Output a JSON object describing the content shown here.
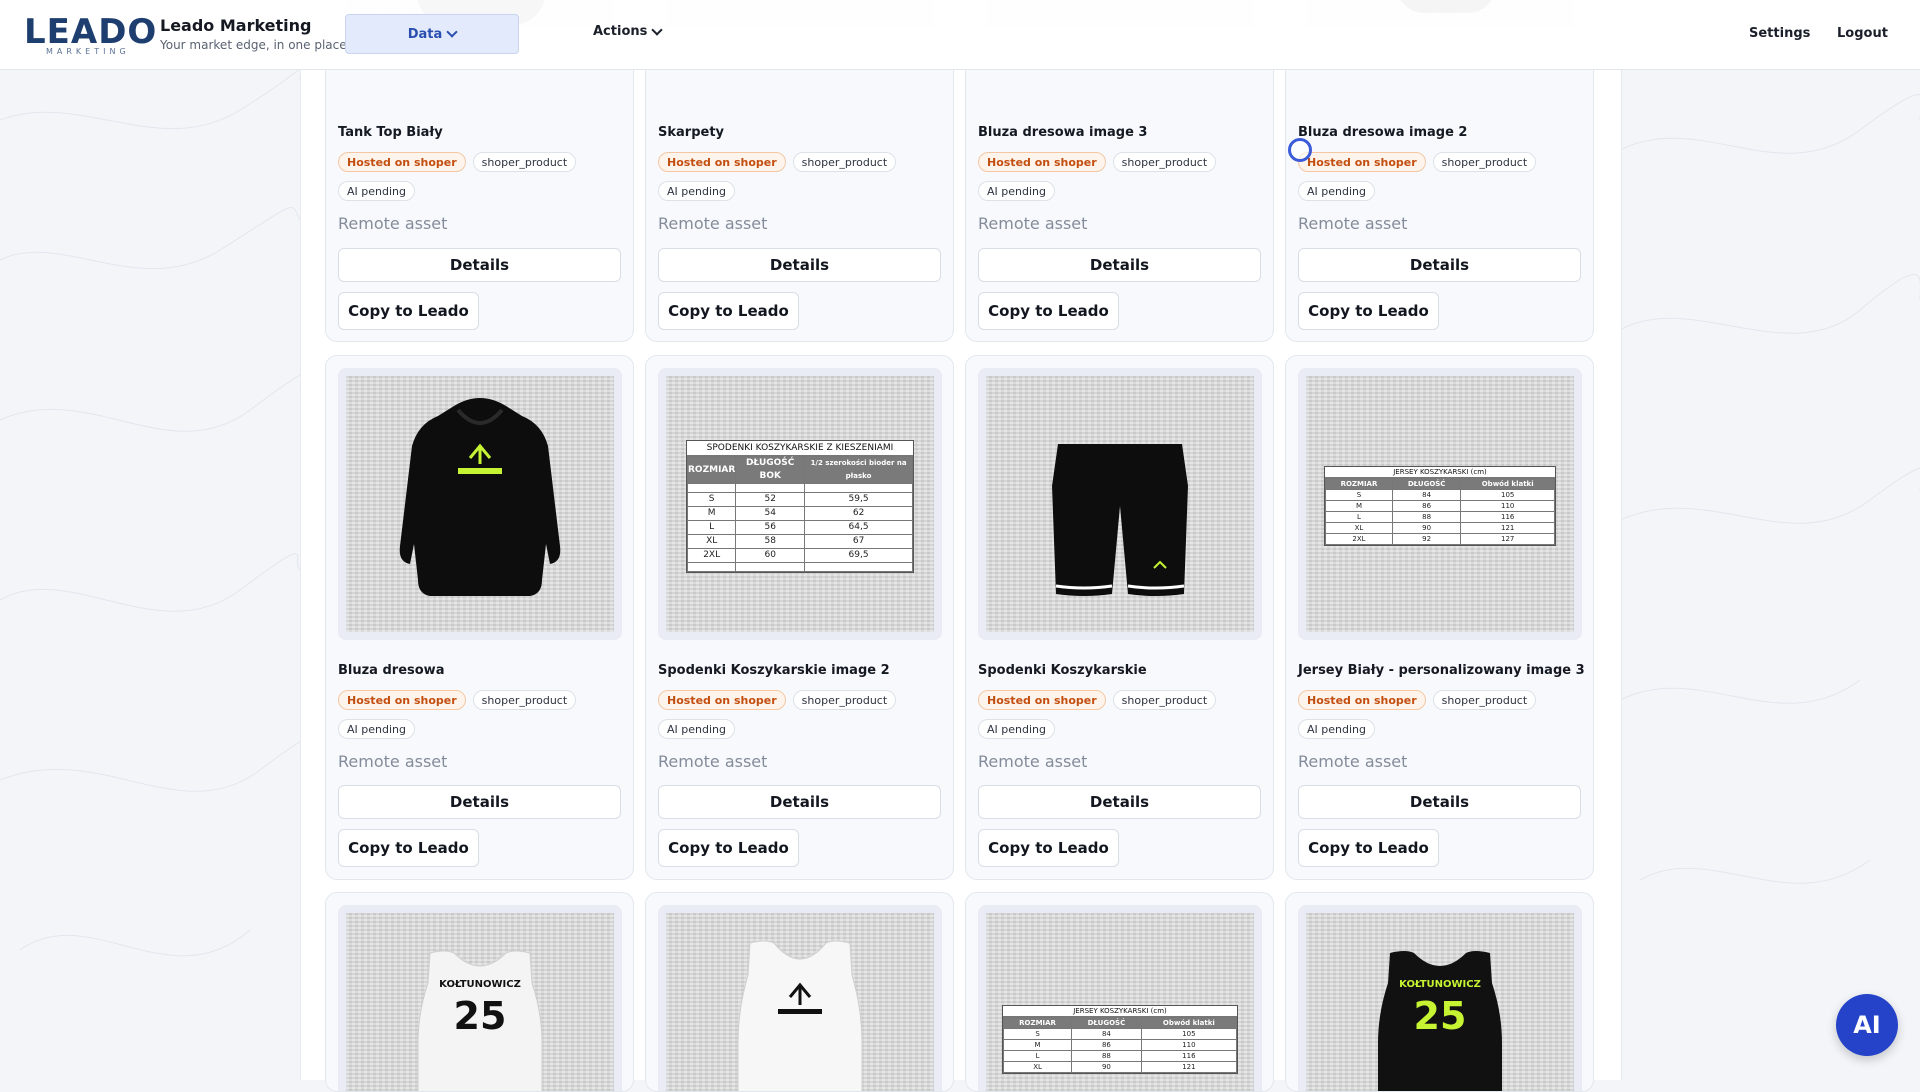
{
  "header": {
    "logo_text": "LEADO",
    "logo_sub": "MARKETING",
    "app_name": "Leado Marketing",
    "tagline": "Your market edge, in one place",
    "menu_data": "Data",
    "menu_actions": "Actions",
    "settings": "Settings",
    "logout": "Logout"
  },
  "cards": [
    {
      "title": "Tank Top Biały",
      "host_tag": "Hosted on shoper",
      "source_tag": "shoper_product",
      "ai_tag": "AI pending",
      "remote": "Remote asset",
      "details": "Details",
      "copy": "Copy to Leado"
    },
    {
      "title": "Skarpety",
      "host_tag": "Hosted on shoper",
      "source_tag": "shoper_product",
      "ai_tag": "AI pending",
      "remote": "Remote asset",
      "details": "Details",
      "copy": "Copy to Leado"
    },
    {
      "title": "Bluza dresowa image 3",
      "host_tag": "Hosted on shoper",
      "source_tag": "shoper_product",
      "ai_tag": "AI pending",
      "remote": "Remote asset",
      "details": "Details",
      "copy": "Copy to Leado"
    },
    {
      "title": "Bluza dresowa image 2",
      "host_tag": "Hosted on shoper",
      "source_tag": "shoper_product",
      "ai_tag": "AI pending",
      "remote": "Remote asset",
      "details": "Details",
      "copy": "Copy to Leado"
    },
    {
      "title": "Bluza dresowa",
      "host_tag": "Hosted on shoper",
      "source_tag": "shoper_product",
      "ai_tag": "AI pending",
      "remote": "Remote asset",
      "details": "Details",
      "copy": "Copy to Leado"
    },
    {
      "title": "Spodenki Koszykarskie image 2",
      "host_tag": "Hosted on shoper",
      "source_tag": "shoper_product",
      "ai_tag": "AI pending",
      "remote": "Remote asset",
      "details": "Details",
      "copy": "Copy to Leado"
    },
    {
      "title": "Spodenki Koszykarskie",
      "host_tag": "Hosted on shoper",
      "source_tag": "shoper_product",
      "ai_tag": "AI pending",
      "remote": "Remote asset",
      "details": "Details",
      "copy": "Copy to Leado"
    },
    {
      "title": "Jersey Biały - personalizowany image 3",
      "host_tag": "Hosted on shoper",
      "source_tag": "shoper_product",
      "ai_tag": "AI pending",
      "remote": "Remote asset",
      "details": "Details",
      "copy": "Copy to Leado"
    }
  ],
  "size_table_shorts": {
    "title": "SPODENKI KOSZYKARSKIE Z KIESZENIAMI",
    "headers": [
      "ROZMIAR",
      "DŁUGOŚĆ BOK",
      "1/2 szerokości bioder na płasko"
    ],
    "rows": [
      [
        "S",
        "52",
        "59,5"
      ],
      [
        "M",
        "54",
        "62"
      ],
      [
        "L",
        "56",
        "64,5"
      ],
      [
        "XL",
        "58",
        "67"
      ],
      [
        "2XL",
        "60",
        "69,5"
      ]
    ]
  },
  "size_table_jersey": {
    "title": "JERSEY KOSZYKARSKI (cm)",
    "headers": [
      "ROZMIAR",
      "DŁUGOŚĆ",
      "Obwód klatki"
    ],
    "rows": [
      [
        "S",
        "84",
        "105"
      ],
      [
        "M",
        "86",
        "110"
      ],
      [
        "L",
        "88",
        "116"
      ],
      [
        "XL",
        "90",
        "121"
      ],
      [
        "2XL",
        "92",
        "127"
      ]
    ]
  },
  "jersey_print": {
    "name": "KOŁTUNOWICZ",
    "number": "25"
  },
  "ai_button": "AI",
  "colors": {
    "accent": "#2443c9",
    "host_tag": "#c24f10",
    "brand": "#1d3e6e"
  }
}
